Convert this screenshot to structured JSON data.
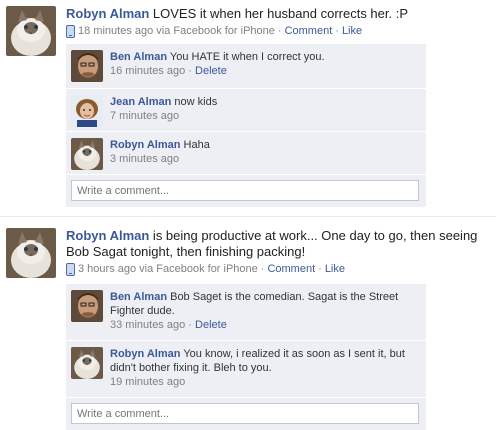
{
  "posts": [
    {
      "author": "Robyn Alman",
      "text": " LOVES it when her husband corrects her. :P",
      "time": "18 minutes ago via Facebook for iPhone",
      "sep1": "·",
      "comment_label": "Comment",
      "sep2": "·",
      "like_label": "Like",
      "comments": [
        {
          "author": "Ben Alman",
          "text": " You HATE it when I correct you.",
          "time": "16 minutes ago",
          "sep": "·",
          "delete_label": "Delete"
        },
        {
          "author": "Jean Alman",
          "text": " now kids",
          "time": "7 minutes ago"
        },
        {
          "author": "Robyn Alman",
          "text": " Haha",
          "time": "3 minutes ago"
        }
      ],
      "write_placeholder": "Write a comment..."
    },
    {
      "author": "Robyn Alman",
      "text": " is being productive at work... One day to go, then seeing Bob Sagat tonight, then finishing packing!",
      "time": "3 hours ago via Facebook for iPhone",
      "sep1": "·",
      "comment_label": "Comment",
      "sep2": "·",
      "like_label": "Like",
      "comments": [
        {
          "author": "Ben Alman",
          "text": " Bob Saget is the comedian. Sagat is the Street Fighter dude.",
          "time": "33 minutes ago",
          "sep": "·",
          "delete_label": "Delete"
        },
        {
          "author": "Robyn Alman",
          "text": " You know, i realized it as soon as I sent it, but didn't bother fixing it. Bleh to you.",
          "time": "19 minutes ago"
        }
      ],
      "write_placeholder": "Write a comment..."
    }
  ],
  "icons": {
    "platform": "phone-icon"
  },
  "colors": {
    "link": "#3b5998",
    "comment_bg": "#edeff4",
    "meta": "#808080"
  }
}
